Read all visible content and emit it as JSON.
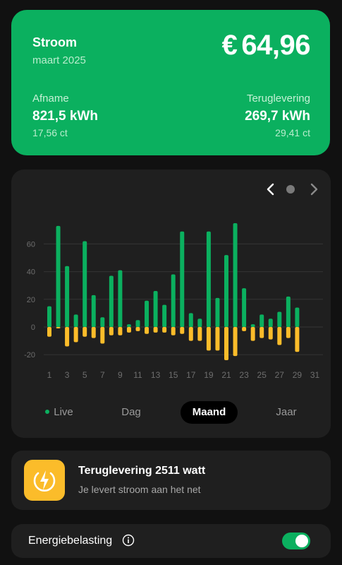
{
  "summary": {
    "title": "Stroom",
    "period": "maart 2025",
    "currency": "€",
    "amount": "64,96",
    "afname": {
      "label": "Afname",
      "value": "821,5 kWh",
      "price": "17,56 ct"
    },
    "teruglevering": {
      "label": "Teruglevering",
      "value": "269,7 kWh",
      "price": "29,41 ct"
    }
  },
  "colors": {
    "green": "#0bb05f",
    "yellow": "#fbbc2a"
  },
  "chart_data": {
    "type": "bar",
    "x": [
      1,
      2,
      3,
      4,
      5,
      6,
      7,
      8,
      9,
      10,
      11,
      12,
      13,
      14,
      15,
      16,
      17,
      18,
      19,
      20,
      21,
      22,
      23,
      24,
      25,
      26,
      27,
      28,
      29,
      30,
      31
    ],
    "x_tick_labels": [
      "1",
      "3",
      "5",
      "7",
      "9",
      "11",
      "13",
      "15",
      "17",
      "19",
      "21",
      "23",
      "25",
      "27",
      "29",
      "31"
    ],
    "y_ticks": [
      60,
      40,
      20,
      0,
      -20
    ],
    "ylim": [
      -26,
      78
    ],
    "grid": true,
    "series": [
      {
        "color": "#0bb05f",
        "values": [
          15,
          73,
          44,
          9,
          62,
          23,
          7,
          37,
          41,
          2,
          5,
          19,
          26,
          16,
          38,
          69,
          10,
          6,
          69,
          21,
          52,
          75,
          28,
          2,
          9,
          6,
          11,
          22,
          14,
          null,
          null
        ]
      },
      {
        "color": "#fbbc2a",
        "values": [
          -7,
          -1,
          -14,
          -11,
          -7,
          -8,
          -12,
          -6,
          -6,
          -4,
          -3,
          -5,
          -4,
          -4,
          -6,
          -5,
          -10,
          -10,
          -17,
          -17,
          -24,
          -21,
          -3,
          -10,
          -8,
          -9,
          -13,
          -8,
          -18,
          null,
          null
        ]
      }
    ]
  },
  "tabs": [
    {
      "label": "Live",
      "active": false
    },
    {
      "label": "Dag",
      "active": false
    },
    {
      "label": "Maand",
      "active": true
    },
    {
      "label": "Jaar",
      "active": false
    }
  ],
  "info": {
    "title": "Teruglevering 2511 watt",
    "subtitle": "Je levert stroom aan het net",
    "icon": "bolt-icon"
  },
  "tax": {
    "label": "Energiebelasting",
    "enabled": true
  }
}
